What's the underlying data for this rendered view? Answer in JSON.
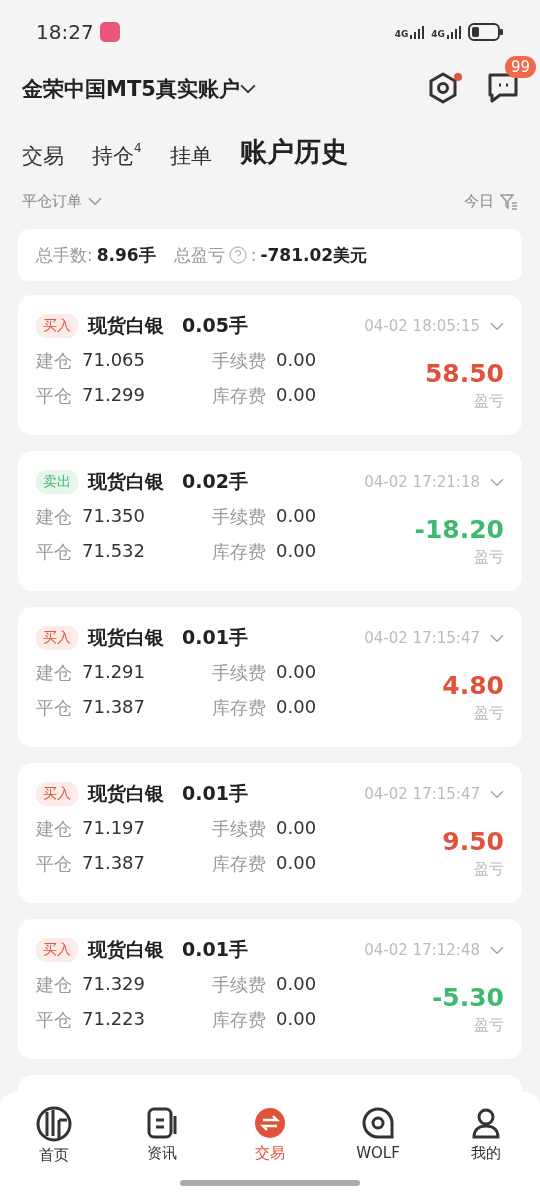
{
  "status_bar": {
    "time": "18:27",
    "signal_1": "4G",
    "signal_2": "4G"
  },
  "header": {
    "account": "金荣中国MT5真实账户",
    "settings_dot": true,
    "message_badge": "99"
  },
  "tabs": [
    {
      "label": "交易",
      "selected": false
    },
    {
      "label": "持仓",
      "sup": "4",
      "selected": false
    },
    {
      "label": "挂单",
      "selected": false
    },
    {
      "label": "账户历史",
      "selected": true
    }
  ],
  "filter": {
    "order_type": "平仓订单",
    "date": "今日"
  },
  "summary": {
    "lots_label": "总手数:",
    "lots": "8.96手",
    "pnl_label": "总盈亏",
    "pnl_colon": ":",
    "pnl": "-781.02美元"
  },
  "orders": [
    {
      "kind": "buy",
      "side_label": "买入",
      "symbol": "现货白银",
      "lots": "0.05手",
      "time": "04-02 18:05:15",
      "open_label": "建仓",
      "open": "71.065",
      "close_label": "平仓",
      "close": "71.299",
      "fee_label": "手续费",
      "fee": "0.00",
      "swap_label": "库存费",
      "swap": "0.00",
      "pnl": "58.50",
      "color": "#e0533a",
      "pnl_label": "盈亏"
    },
    {
      "kind": "sell",
      "side_label": "卖出",
      "symbol": "现货白银",
      "lots": "0.02手",
      "time": "04-02 17:21:18",
      "open_label": "建仓",
      "open": "71.350",
      "close_label": "平仓",
      "close": "71.532",
      "fee_label": "手续费",
      "fee": "0.00",
      "swap_label": "库存费",
      "swap": "0.00",
      "pnl": "-18.20",
      "color": "#3fb96f",
      "pnl_label": "盈亏"
    },
    {
      "kind": "buy",
      "side_label": "买入",
      "symbol": "现货白银",
      "lots": "0.01手",
      "time": "04-02 17:15:47",
      "open_label": "建仓",
      "open": "71.291",
      "close_label": "平仓",
      "close": "71.387",
      "fee_label": "手续费",
      "fee": "0.00",
      "swap_label": "库存费",
      "swap": "0.00",
      "pnl": "4.80",
      "color": "#e0533a",
      "pnl_label": "盈亏"
    },
    {
      "kind": "buy",
      "side_label": "买入",
      "symbol": "现货白银",
      "lots": "0.01手",
      "time": "04-02 17:15:47",
      "open_label": "建仓",
      "open": "71.197",
      "close_label": "平仓",
      "close": "71.387",
      "fee_label": "手续费",
      "fee": "0.00",
      "swap_label": "库存费",
      "swap": "0.00",
      "pnl": "9.50",
      "color": "#e0533a",
      "pnl_label": "盈亏"
    },
    {
      "kind": "buy",
      "side_label": "买入",
      "symbol": "现货白银",
      "lots": "0.01手",
      "time": "04-02 17:12:48",
      "open_label": "建仓",
      "open": "71.329",
      "close_label": "平仓",
      "close": "71.223",
      "fee_label": "手续费",
      "fee": "0.00",
      "swap_label": "库存费",
      "swap": "0.00",
      "pnl": "-5.30",
      "color": "#3fb96f",
      "pnl_label": "盈亏"
    }
  ],
  "bottom_nav": [
    {
      "label": "首页",
      "selected": false
    },
    {
      "label": "资讯",
      "selected": false
    },
    {
      "label": "交易",
      "selected": true
    },
    {
      "label": "WOLF",
      "selected": false
    },
    {
      "label": "我的",
      "selected": false
    }
  ]
}
